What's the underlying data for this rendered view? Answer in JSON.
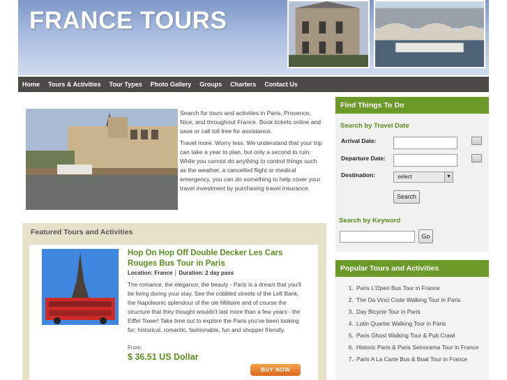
{
  "header": {
    "brand": "FRANCE TOURS"
  },
  "nav": {
    "items": [
      "Home",
      "Tours & Activities",
      "Tour Types",
      "Photo Gallery",
      "Groups",
      "Charters",
      "Contact Us"
    ]
  },
  "intro": {
    "p1": "Search for tours and activities in Paris, Provence, Nice, and throughout France. Book tickets online and save or call toll free for assistance.",
    "p2": "Travel more.  Worry less.  We understand that your trip can take a year to plan, but only a second to ruin. While you cannot do anything to control things such as the weather, a cancelled flight or medical emergency, you can do something to help cover your travel investment by purchasing travel insurance."
  },
  "featured": {
    "title": "Featured Tours and Activities",
    "tour": {
      "title": "Hop On Hop Off Double Decker Les Cars Rouges Bus Tour in Paris",
      "location": "Location: France",
      "duration": "Duration: 2 day pass",
      "description": "The romance, the elegance, the beauty - Paris is a dream that you'll be living during your stay. See the cobbled streets of the Left Bank, the Napoleonic splendour of the ole Militaire and of course the structure that they thought wouldn't last more than a few years - the Eiffel Tower! Take time out to explore the Paris you've been looking for; historical, romantic, fashionable, fun and shopper friendly.",
      "from_label": "From:",
      "price": "$ 36.51 US Dollar",
      "buy_label": "BUY NOW"
    }
  },
  "find": {
    "title": "Find Things To Do",
    "travel_date_heading": "Search by Travel Date",
    "arrival_label": "Arrival Date:",
    "departure_label": "Departure Date:",
    "destination_label": "Destination:",
    "destination_value": "select",
    "search_button": "Search",
    "keyword_heading": "Search by Keyword",
    "go_button": "Go"
  },
  "popular": {
    "title": "Popular Tours and Activities",
    "items": [
      "Paris L'Open Bus Tour in France",
      "The Da Vinci Code Walking Tour in Paris",
      "Day Bicycle Tour in Paris",
      "Latin Quarter Walking Tour in Paris",
      "Paris Ghost Walking Tour & Pub Crawl",
      "Historic Paris & Paris Seinorama Tour in France",
      "Paris A La Carte Bus & Boat Tour in France"
    ]
  },
  "colors": {
    "accent_green": "#6b9a28",
    "nav_bg": "#4b4a47",
    "featured_bg": "#e6e1c8",
    "buy_orange": "#e5782a"
  }
}
